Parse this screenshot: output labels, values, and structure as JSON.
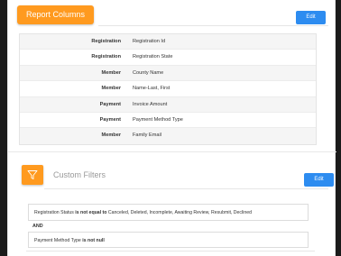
{
  "report_columns": {
    "title": "Report Columns",
    "edit_label": "Edit",
    "rows": [
      {
        "key": "Registration",
        "value": "Registration Id"
      },
      {
        "key": "Registration",
        "value": "Registration State"
      },
      {
        "key": "Member",
        "value": "County Name"
      },
      {
        "key": "Member",
        "value": "Name-Last, First"
      },
      {
        "key": "Payment",
        "value": "Invoice Amount"
      },
      {
        "key": "Payment",
        "value": "Payment Method Type"
      },
      {
        "key": "Member",
        "value": "Family Email"
      }
    ]
  },
  "custom_filters": {
    "title": "Custom Filters",
    "edit_label": "Edit",
    "icon": "filter-icon",
    "filter1": {
      "field": "Registration Status",
      "operator": "is not equal to",
      "values": "Canceled, Deleted, Incomplete, Awaiting Review, Resubmit, Declined"
    },
    "joiner": "AND",
    "filter2": {
      "field": "Payment Method Type",
      "operator": "is not null"
    }
  },
  "colors": {
    "accent_orange": "#ff9a1f",
    "button_blue": "#2d8cf0"
  }
}
